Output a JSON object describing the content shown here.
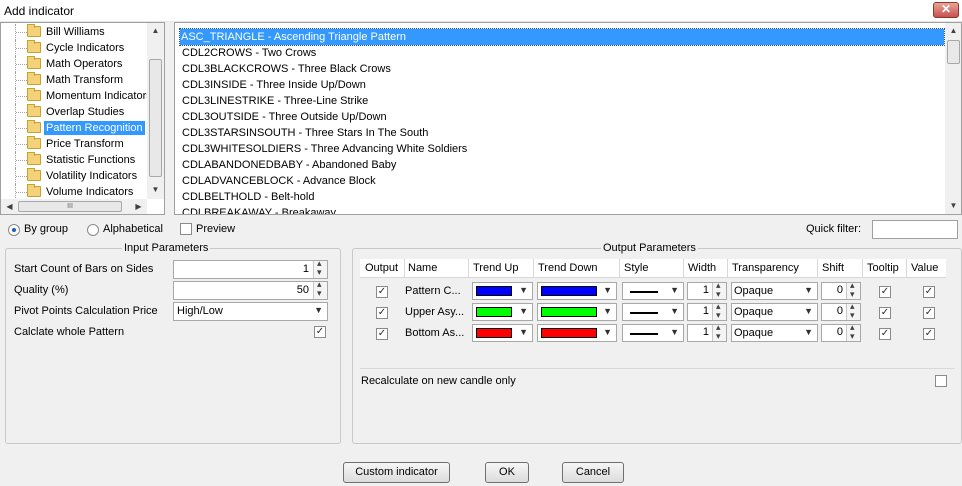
{
  "window": {
    "title": "Add indicator",
    "close_label": "✕"
  },
  "tree": {
    "items": [
      {
        "label": "Bill Williams",
        "selected": false
      },
      {
        "label": "Cycle Indicators",
        "selected": false
      },
      {
        "label": "Math Operators",
        "selected": false
      },
      {
        "label": "Math Transform",
        "selected": false
      },
      {
        "label": "Momentum Indicators",
        "selected": false
      },
      {
        "label": "Overlap Studies",
        "selected": false
      },
      {
        "label": "Pattern Recognition",
        "selected": true
      },
      {
        "label": "Price Transform",
        "selected": false
      },
      {
        "label": "Statistic Functions",
        "selected": false
      },
      {
        "label": "Volatility Indicators",
        "selected": false
      },
      {
        "label": "Volume Indicators",
        "selected": false
      }
    ],
    "hscroll_grip": "III"
  },
  "patterns": [
    "ASC_TRIANGLE - Ascending Triangle Pattern",
    "CDL2CROWS - Two Crows",
    "CDL3BLACKCROWS - Three Black Crows",
    "CDL3INSIDE - Three Inside Up/Down",
    "CDL3LINESTRIKE - Three-Line Strike",
    "CDL3OUTSIDE - Three Outside Up/Down",
    "CDL3STARSINSOUTH - Three Stars In The South",
    "CDL3WHITESOLDIERS - Three Advancing White Soldiers",
    "CDLABANDONEDBABY - Abandoned Baby",
    "CDLADVANCEBLOCK - Advance Block",
    "CDLBELTHOLD - Belt-hold",
    "CDLBREAKAWAY - Breakaway"
  ],
  "view_options": {
    "by_group": "By group",
    "alphabetical": "Alphabetical",
    "preview": "Preview",
    "quick_filter_label": "Quick filter:",
    "quick_filter_value": ""
  },
  "input_params": {
    "title": "Input Parameters",
    "start_count_label": "Start Count of Bars on Sides",
    "start_count_value": "1",
    "quality_label": "Quality (%)",
    "quality_value": "50",
    "pivot_label": "Pivot Points Calculation Price",
    "pivot_value": "High/Low",
    "calc_whole_label": "Calclate whole Pattern",
    "calc_whole_checked": true
  },
  "output_params": {
    "title": "Output Parameters",
    "headers": [
      "Output",
      "Name",
      "Trend Up",
      "Trend Down",
      "Style",
      "Width",
      "Transparency",
      "Shift",
      "Tooltip",
      "Value"
    ],
    "rows": [
      {
        "output": true,
        "name": "Pattern C...",
        "trend_up": "#0000ff",
        "trend_down": "#0000ff",
        "width": "1",
        "transparency": "Opaque",
        "shift": "0",
        "tooltip": true,
        "value": true
      },
      {
        "output": true,
        "name": "Upper Asy...",
        "trend_up": "#00ff00",
        "trend_down": "#00ff00",
        "width": "1",
        "transparency": "Opaque",
        "shift": "0",
        "tooltip": true,
        "value": true
      },
      {
        "output": true,
        "name": "Bottom As...",
        "trend_up": "#ff0000",
        "trend_down": "#ff0000",
        "width": "1",
        "transparency": "Opaque",
        "shift": "0",
        "tooltip": true,
        "value": true
      }
    ],
    "recalc_label": "Recalculate on new candle only",
    "recalc_checked": false
  },
  "buttons": {
    "custom": "Custom indicator",
    "ok": "OK",
    "cancel": "Cancel"
  },
  "check_mark": "✓",
  "icons": [
    "folder-icon",
    "close-icon",
    "scroll-up-icon",
    "scroll-down-icon",
    "dropdown-arrow-icon",
    "spinner-icon"
  ]
}
